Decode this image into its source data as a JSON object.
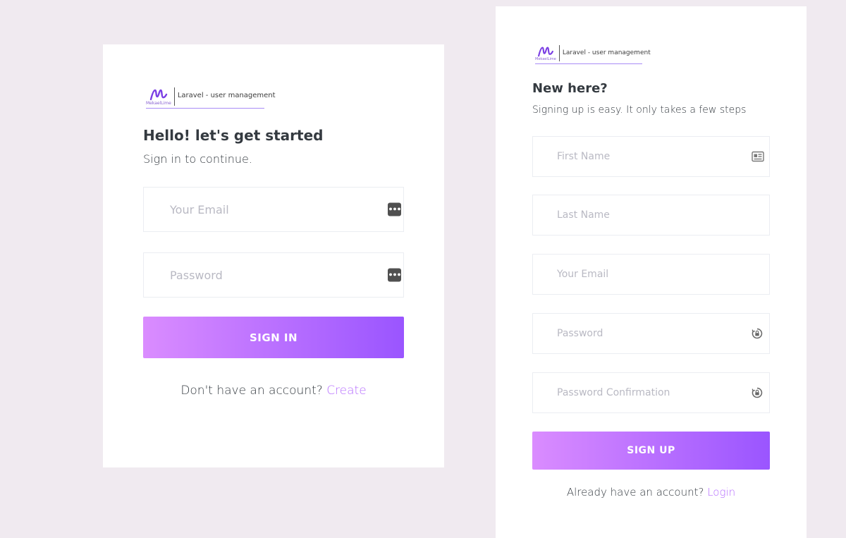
{
  "colors": {
    "page_background": "#f0eaf0",
    "card_background": "#ffffff",
    "primary_gradient_start": "#da8cff",
    "primary_gradient_end": "#9a55ff",
    "link": "#b66dff",
    "text": "#343a40",
    "placeholder": "#b9b9c3"
  },
  "logo": {
    "mark_subtext": "MekaelLime",
    "app_name": "Laravel - user management"
  },
  "signin": {
    "title": "Hello! let's get started",
    "subtitle": "Sign in to continue.",
    "fields": [
      {
        "placeholder": "Your Email",
        "value": "",
        "icon": "dots-icon"
      },
      {
        "placeholder": "Password",
        "value": "",
        "icon": "dots-icon"
      }
    ],
    "submit_label": "SIGN IN",
    "footer_text": "Don't have an account?",
    "footer_link": "Create"
  },
  "signup": {
    "title": "New here?",
    "subtitle": "Signing up is easy. It only takes a few steps",
    "fields": [
      {
        "placeholder": "First Name",
        "value": "",
        "icon": "id-card-icon"
      },
      {
        "placeholder": "Last Name",
        "value": ""
      },
      {
        "placeholder": "Your Email",
        "value": ""
      },
      {
        "placeholder": "Password",
        "value": "",
        "icon": "lock-icon"
      },
      {
        "placeholder": "Password Confirmation",
        "value": "",
        "icon": "lock-icon"
      }
    ],
    "submit_label": "SIGN UP",
    "footer_text": "Already have an account?",
    "footer_link": "Login"
  }
}
